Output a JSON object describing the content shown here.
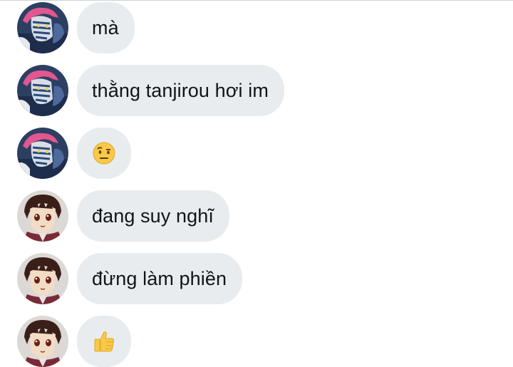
{
  "messages": [
    {
      "sender": "pink-hair-character",
      "text": "mà"
    },
    {
      "sender": "pink-hair-character",
      "text": "thằng tanjirou hơi im"
    },
    {
      "sender": "pink-hair-character",
      "emoji": "raised-eyebrow-emoji"
    },
    {
      "sender": "tanjiro",
      "text": "đang suy nghĩ"
    },
    {
      "sender": "tanjiro",
      "text": "đừng làm phiền"
    },
    {
      "sender": "tanjiro",
      "emoji": "thumbs-up-emoji"
    }
  ],
  "colors": {
    "bubble": "#e9ecef",
    "text": "#111418",
    "background": "#ffffff"
  }
}
